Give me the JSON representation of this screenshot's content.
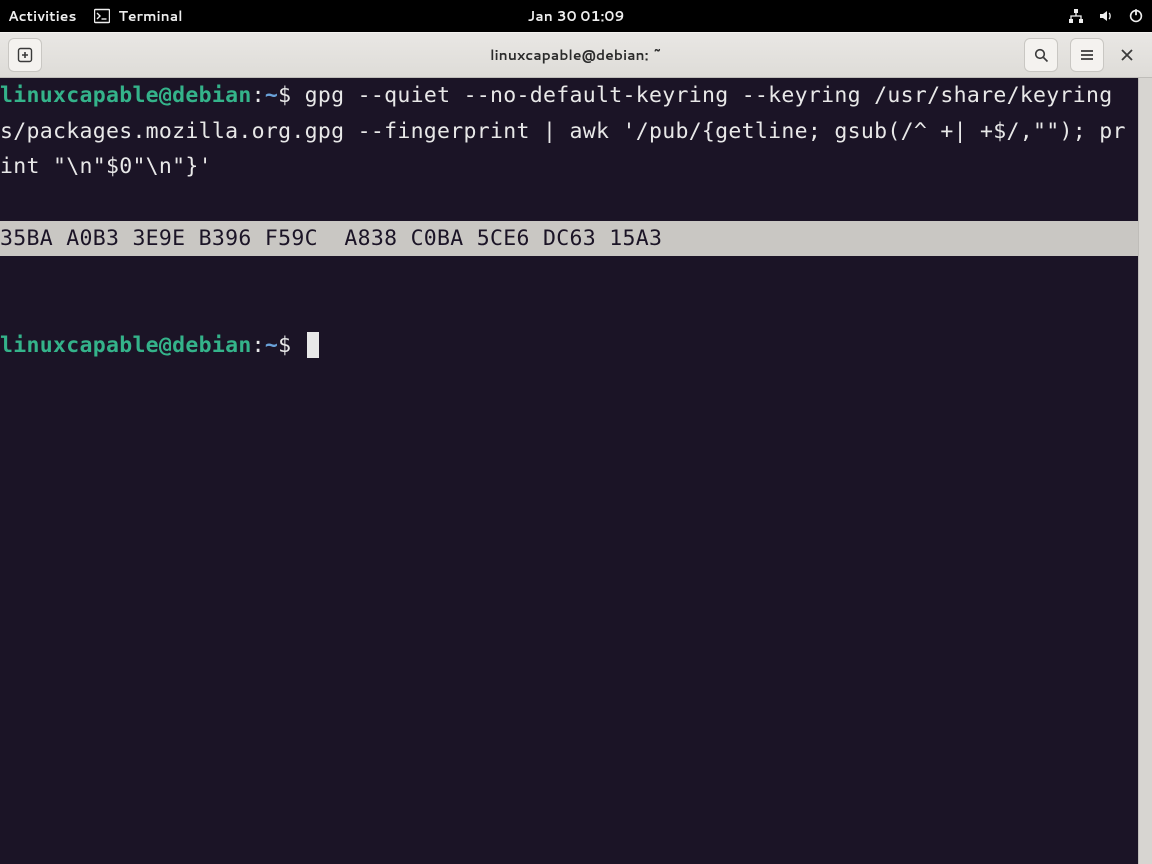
{
  "topbar": {
    "activities": "Activities",
    "app_name": "Terminal",
    "clock": "Jan 30  01:09"
  },
  "headerbar": {
    "title": "linuxcapable@debian: ~"
  },
  "terminal": {
    "prompt_user": "linuxcapable@debian",
    "prompt_colon": ":",
    "prompt_path": "~",
    "prompt_dollar": "$",
    "command": " gpg --quiet --no-default-keyring --keyring /usr/share/keyrings/packages.mozilla.org.gpg --fingerprint | awk '/pub/{getline; gsub(/^ +| +$/,\"\"); print \"\\n\"$0\"\\n\"}'",
    "output_fingerprint": "35BA A0B3 3E9E B396 F59C  A838 C0BA 5CE6 DC63 15A3"
  }
}
